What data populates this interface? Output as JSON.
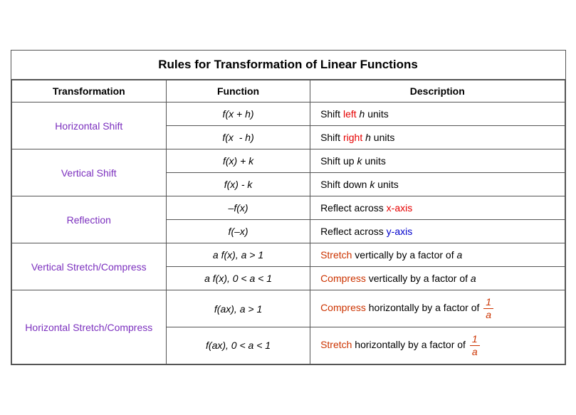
{
  "title": "Rules for Transformation of Linear Functions",
  "headers": [
    "Transformation",
    "Function",
    "Description"
  ],
  "rows": [
    {
      "transformation": "Horizontal Shift",
      "rowspan": 2,
      "sub": [
        {
          "function": "f(x + h)",
          "description": "Shift {left} h units",
          "left_colored": "left",
          "color": "red"
        },
        {
          "function": "f(x  - h)",
          "description": "Shift {right} h units",
          "right_colored": "right",
          "color": "red"
        }
      ]
    },
    {
      "transformation": "Vertical Shift",
      "rowspan": 2,
      "sub": [
        {
          "function": "f(x) + k",
          "description": "Shift up k units"
        },
        {
          "function": "f(x) - k",
          "description": "Shift down k units"
        }
      ]
    },
    {
      "transformation": "Reflection",
      "rowspan": 2,
      "sub": [
        {
          "function": "–f(x)",
          "description": "Reflect across {x-axis}",
          "colored": "x-axis",
          "color": "red"
        },
        {
          "function": "f(–x)",
          "description": "Reflect across {y-axis}",
          "colored": "y-axis",
          "color": "blue"
        }
      ]
    },
    {
      "transformation": "Vertical Stretch/Compress",
      "rowspan": 2,
      "sub": [
        {
          "function": "a f(x), a > 1",
          "description": "{Stretch} vertically by a factor of a",
          "colored": "Stretch",
          "color": "orange-red"
        },
        {
          "function": "a f(x), 0 < a < 1",
          "description": "{Compress} vertically by a factor of a",
          "colored": "Compress",
          "color": "orange-red"
        }
      ]
    },
    {
      "transformation": "Horizontal Stretch/Compress",
      "rowspan": 2,
      "sub": [
        {
          "function": "f(ax), a > 1",
          "description": "{Compress} horizontally by a factor of 1/a",
          "colored": "Compress",
          "color": "orange-red",
          "fraction": true
        },
        {
          "function": "f(ax), 0 < a < 1",
          "description": "{Stretch} horizontally by a factor of 1/a",
          "colored": "Stretch",
          "color": "orange-red",
          "fraction": true
        }
      ]
    }
  ]
}
